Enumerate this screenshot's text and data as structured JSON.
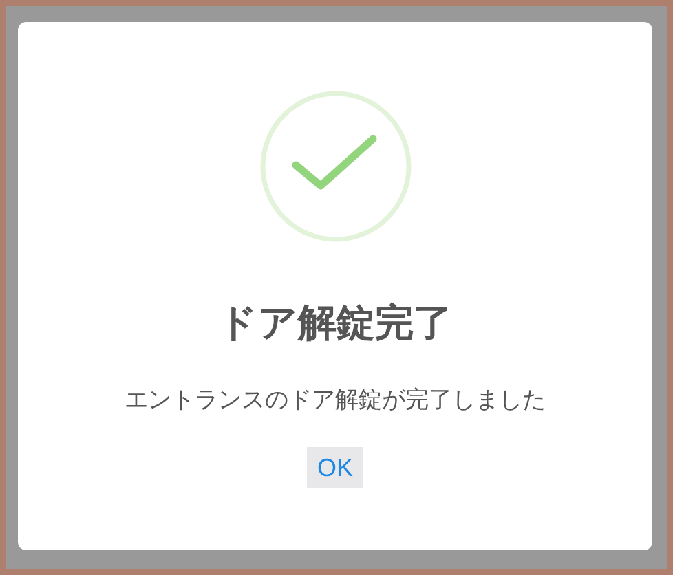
{
  "dialog": {
    "title": "ドア解錠完了",
    "message": "エントランスのドア解錠が完了しました",
    "buttons": [
      "OK"
    ]
  }
}
